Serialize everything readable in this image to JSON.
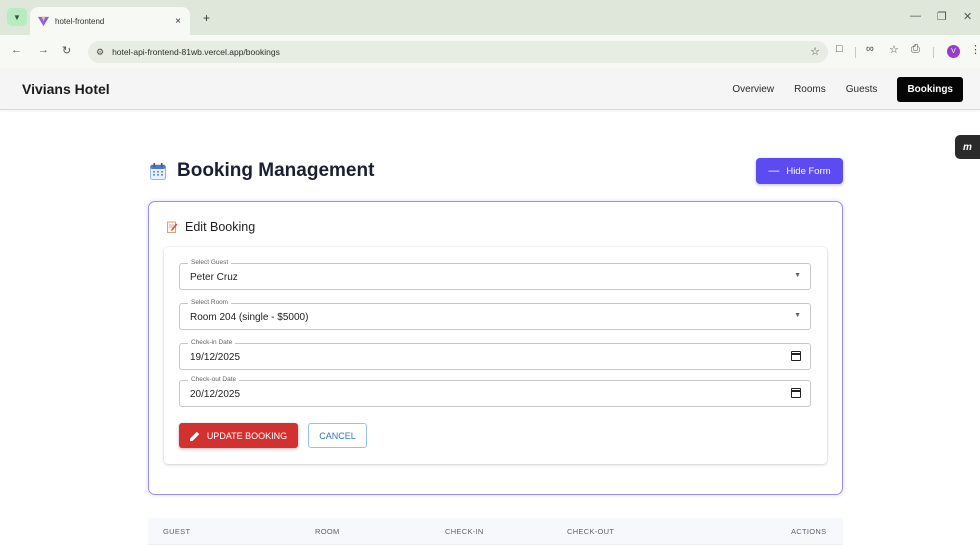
{
  "browser": {
    "tab_title": "hotel-frontend",
    "tab_close": "×",
    "new_tab": "+",
    "url": "hotel-api-frontend-81wb.vercel.app/bookings",
    "profile_initial": "V"
  },
  "header": {
    "brand": "Vivians Hotel",
    "nav": [
      "Overview",
      "Rooms",
      "Guests"
    ],
    "nav_active": "Bookings"
  },
  "page": {
    "title": "Booking Management",
    "hide_form_label": "Hide Form",
    "hide_form_symbol": "—"
  },
  "form": {
    "heading": "Edit Booking",
    "fields": [
      {
        "label": "Select Guest",
        "value": "Peter Cruz",
        "kind": "select"
      },
      {
        "label": "Select Room",
        "value": "Room 204 (single - $5000)",
        "kind": "select"
      },
      {
        "label": "Check-in Date",
        "value": "19/12/2025",
        "kind": "date"
      },
      {
        "label": "Check-out Date",
        "value": "20/12/2025",
        "kind": "date"
      }
    ],
    "update_label": "UPDATE BOOKING",
    "cancel_label": "CANCEL"
  },
  "table": {
    "columns": [
      "GUEST",
      "ROOM",
      "CHECK-IN",
      "CHECK-OUT",
      "ACTIONS"
    ]
  },
  "extension_badge": "m",
  "colors": {
    "accent": "#5b4bf0",
    "danger": "#d33030",
    "nav_active_bg": "#050505"
  }
}
